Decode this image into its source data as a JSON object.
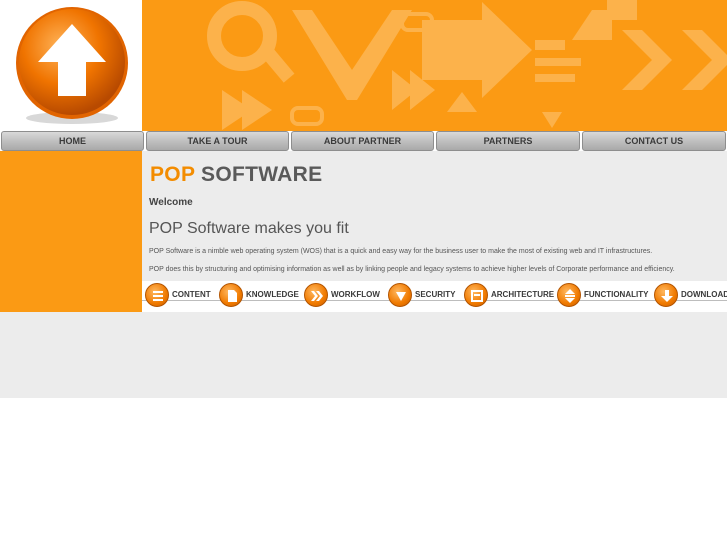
{
  "colors": {
    "accent": "#fb9a14",
    "panel": "#ececec",
    "text": "#555555"
  },
  "logo": {
    "icon": "up-arrow-icon"
  },
  "nav": [
    {
      "label": "HOME"
    },
    {
      "label": "TAKE A TOUR"
    },
    {
      "label": "ABOUT PARTNER"
    },
    {
      "label": "PARTNERS"
    },
    {
      "label": "CONTACT US"
    }
  ],
  "brand": {
    "pop": "POP",
    "software": "SOFTWARE"
  },
  "welcome": "Welcome",
  "headline": "POP Software makes you fit",
  "paragraphs": [
    "POP Software is a nimble web operating system (WOS) that is a quick and easy way for the business user to make the most of existing web and IT infrastructures.",
    "POP does this by structuring and optimising information as well as by linking people and legacy systems to achieve higher levels of Corporate performance and efficiency."
  ],
  "icon_links": [
    {
      "label": "CONTENT",
      "icon": "list-icon"
    },
    {
      "label": "KNOWLEDGE",
      "icon": "document-icon"
    },
    {
      "label": "WORKFLOW",
      "icon": "double-chevron-icon"
    },
    {
      "label": "SECURITY",
      "icon": "shield-icon"
    },
    {
      "label": "ARCHITECTURE",
      "icon": "box-icon"
    },
    {
      "label": "FUNCTIONALITY",
      "icon": "up-down-arrows-icon"
    },
    {
      "label": "DOWNLOADS",
      "icon": "download-arrow-icon"
    }
  ]
}
